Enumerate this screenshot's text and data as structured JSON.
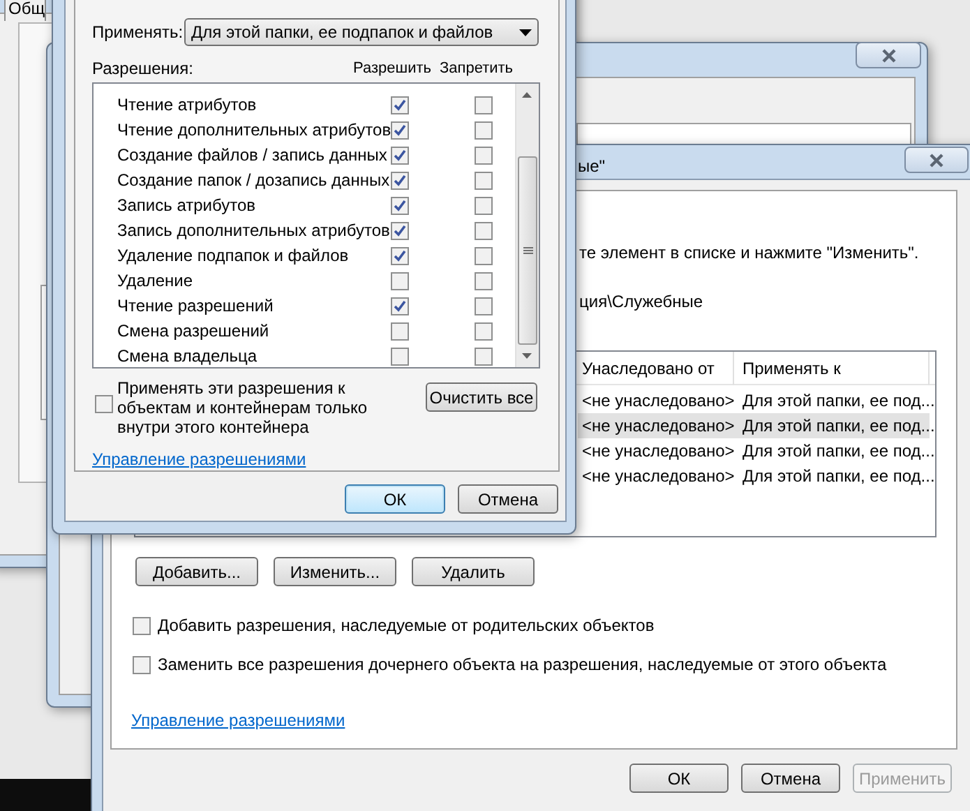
{
  "background_window": {
    "tab": "Общ"
  },
  "security_window": {
    "title_fragment": "ые\"",
    "instruction": "те элемент в списке и нажмите \"Изменить\".",
    "object_path": "ция\\Служебные",
    "table": {
      "columns": [
        "Унаследовано от",
        "Применять к"
      ],
      "rows": [
        {
          "cells": [
            "<не унаследовано>",
            "Для этой папки, ее под..."
          ],
          "selected": false
        },
        {
          "cells": [
            "<не унаследовано>",
            "Для этой папки, ее под..."
          ],
          "selected": true
        },
        {
          "cells": [
            "<не унаследовано>",
            "Для этой папки, ее под..."
          ],
          "selected": false
        },
        {
          "cells": [
            "<не унаследовано>",
            "Для этой папки, ее под..."
          ],
          "selected": false
        }
      ]
    },
    "buttons": [
      "Добавить...",
      "Изменить...",
      "Удалить"
    ],
    "options": [
      {
        "label": "Добавить разрешения, наследуемые от родительских объектов",
        "checked": false
      },
      {
        "label": "Заменить все разрешения дочернего объекта на разрешения, наследуемые от этого объекта",
        "checked": false
      }
    ],
    "link": "Управление разрешениями",
    "footer_buttons": [
      {
        "label": "ОК",
        "disabled": false
      },
      {
        "label": "Отмена",
        "disabled": false
      },
      {
        "label": "Применить",
        "disabled": true
      }
    ]
  },
  "permission_window": {
    "apply_label": "Применять:",
    "apply_value": "Для этой папки, ее подпапок и файлов",
    "permissions_label": "Разрешения:",
    "columns": [
      "Разрешить",
      "Запретить"
    ],
    "permissions": [
      {
        "name": "Чтение атрибутов",
        "allow": true,
        "deny": false
      },
      {
        "name": "Чтение дополнительных атрибутов",
        "allow": true,
        "deny": false
      },
      {
        "name": "Создание файлов / запись данных",
        "allow": true,
        "deny": false
      },
      {
        "name": "Создание папок / дозапись данных",
        "allow": true,
        "deny": false
      },
      {
        "name": "Запись атрибутов",
        "allow": true,
        "deny": false
      },
      {
        "name": "Запись дополнительных атрибутов",
        "allow": true,
        "deny": false
      },
      {
        "name": "Удаление подпапок и файлов",
        "allow": true,
        "deny": false
      },
      {
        "name": "Удаление",
        "allow": false,
        "deny": false
      },
      {
        "name": "Чтение разрешений",
        "allow": true,
        "deny": false
      },
      {
        "name": "Смена разрешений",
        "allow": false,
        "deny": false
      },
      {
        "name": "Смена владельца",
        "allow": false,
        "deny": false
      }
    ],
    "inherit_option": {
      "label": "Применять эти разрешения к объектам и контейнерам только внутри этого контейнера",
      "checked": false
    },
    "clear_button": "Очистить все",
    "link": "Управление разрешениями",
    "buttons": [
      {
        "label": "ОК",
        "default": true
      },
      {
        "label": "Отмена",
        "default": false
      }
    ]
  }
}
